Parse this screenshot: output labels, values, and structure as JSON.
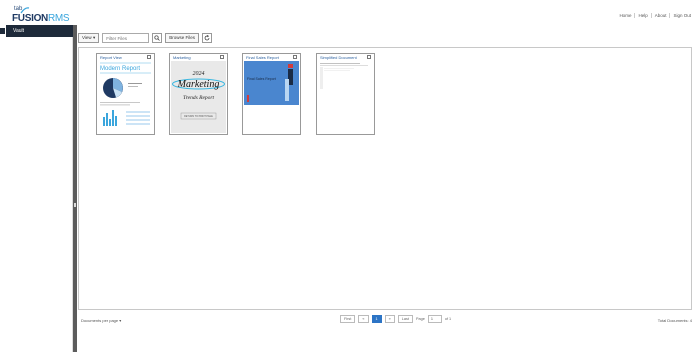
{
  "header": {
    "logo_tab": "tab",
    "logo_fusion": "FUSION",
    "logo_rms": "RMS",
    "nav": [
      "Home",
      "Help",
      "About",
      "Sign Out"
    ]
  },
  "sidebar": {
    "items": [
      {
        "label": "Vault"
      }
    ]
  },
  "toolbar": {
    "view_label": "View",
    "filter_placeholder": "Filter Files",
    "browse_label": "Browse Files"
  },
  "documents": [
    {
      "title": "Report View",
      "thumb_heading": "Modern Report"
    },
    {
      "title": "Marketing",
      "thumb_year": "2024",
      "thumb_heading": "Marketing",
      "thumb_sub": "Trends Report",
      "thumb_button": "RETURN TO PRINT PAGE"
    },
    {
      "title": "Final Sales Report",
      "thumb_heading": "Final Sales Report"
    },
    {
      "title": "Simplified Document"
    }
  ],
  "footer": {
    "docs_per_page": "Documents per page",
    "first": "First",
    "prev": "«",
    "page_num": "1",
    "next": "»",
    "last": "Last",
    "page_label": "Page",
    "page_value": "1",
    "of": "of 1",
    "total": "Total Documents: 4"
  },
  "colors": {
    "sidebar_active": "#1e2a3a",
    "splitter": "#5c5c5c",
    "accent": "#2c74c5",
    "brand_dark": "#1f3a63",
    "brand_light": "#3ba6dd"
  }
}
